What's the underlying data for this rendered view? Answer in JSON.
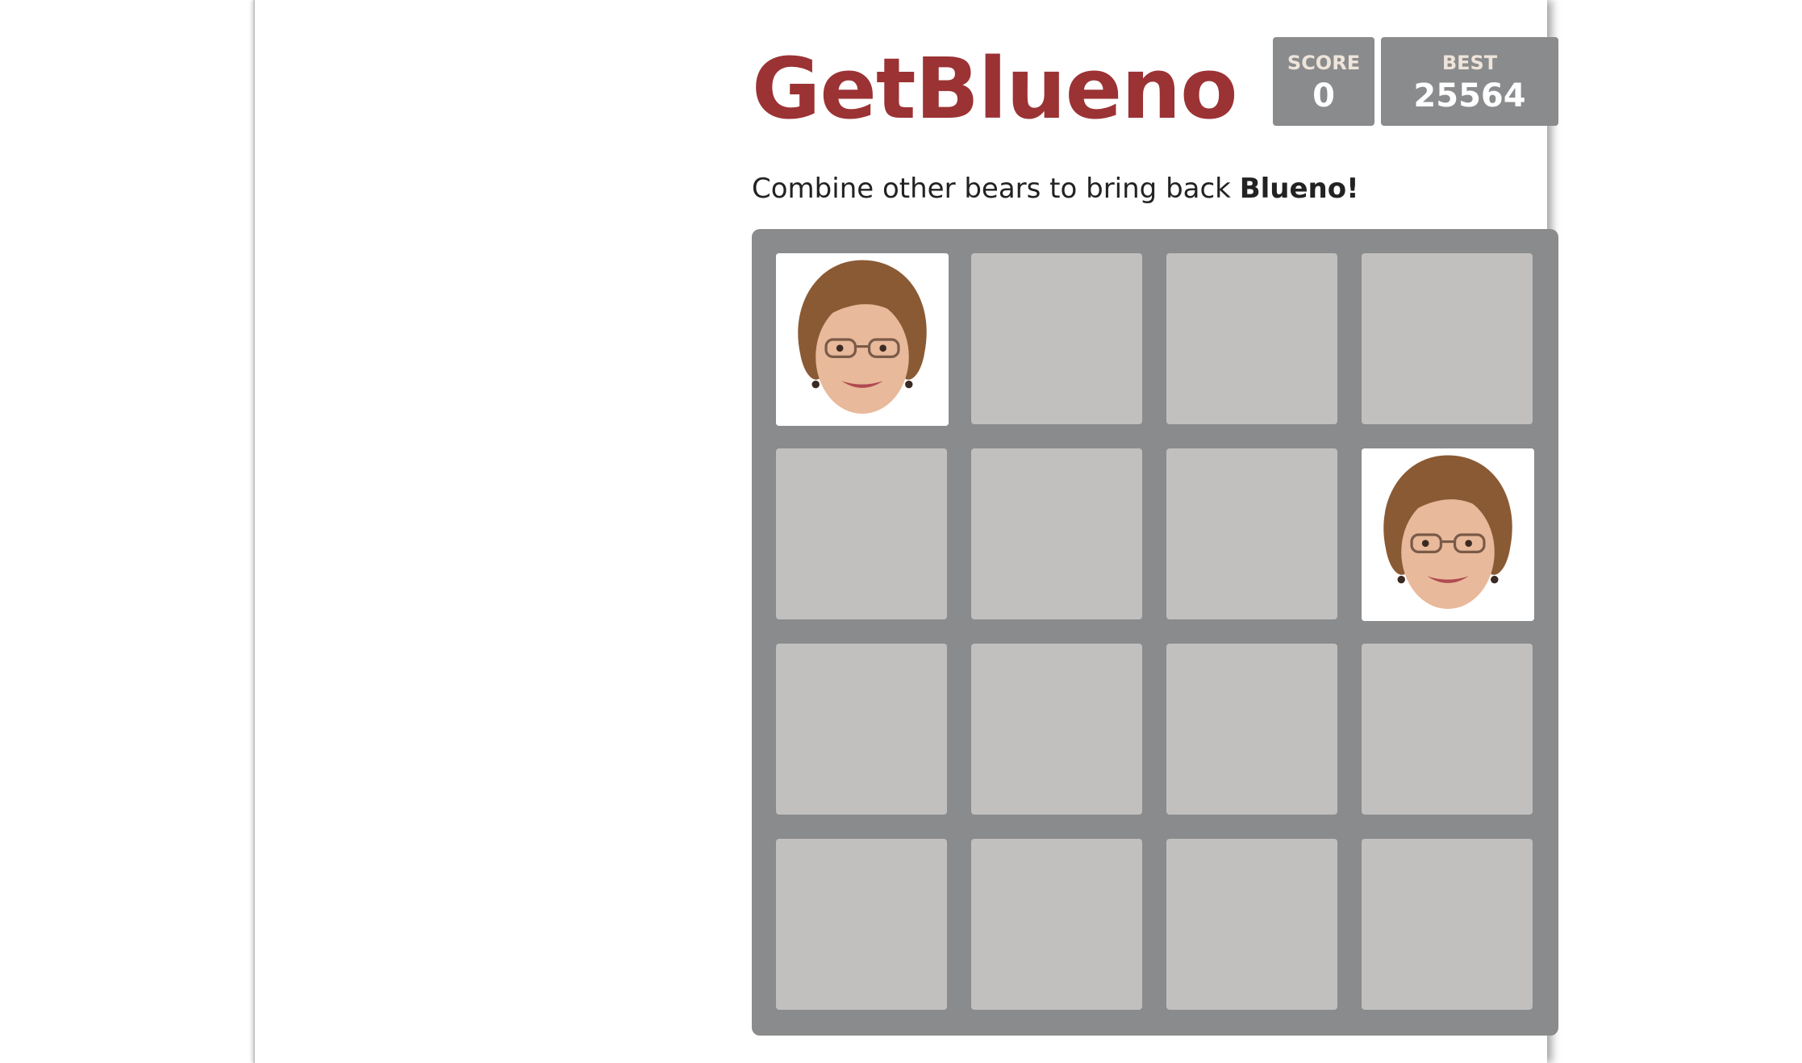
{
  "header": {
    "title": "GetBlueno",
    "score_label": "SCORE",
    "score_value": "0",
    "best_label": "BEST",
    "best_value": "25564"
  },
  "intro": {
    "text": "Combine other bears to bring back ",
    "emphasis": "Blueno!"
  },
  "board": {
    "rows": 4,
    "cols": 4,
    "tiles": [
      {
        "row": 0,
        "col": 0,
        "icon": "portrait-tile-icon"
      },
      {
        "row": 1,
        "col": 3,
        "icon": "portrait-tile-icon"
      }
    ]
  },
  "colors": {
    "title": "#9b3234",
    "board": "#8a8b8c",
    "empty_cell": "#c1c0bf",
    "score_box": "#8a8b8c"
  }
}
